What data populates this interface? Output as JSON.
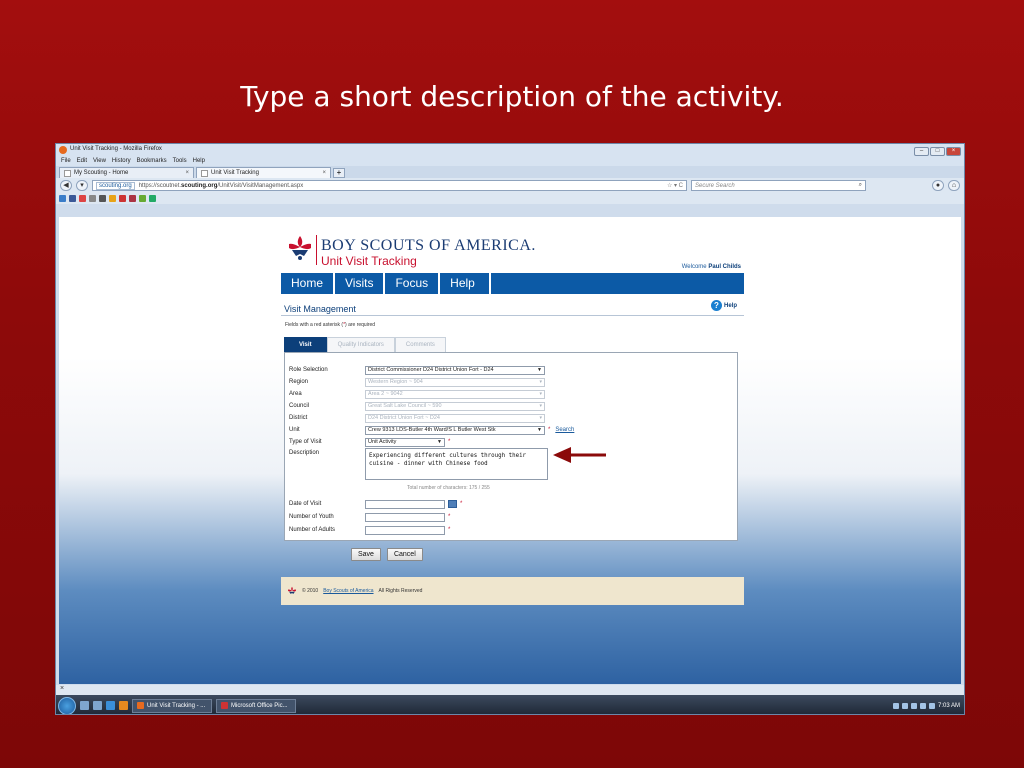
{
  "slide": {
    "title": "Type a short description of the activity."
  },
  "window": {
    "title": "Unit Visit Tracking - Mozilla Firefox",
    "menu": [
      "File",
      "Edit",
      "View",
      "History",
      "Bookmarks",
      "Tools",
      "Help"
    ],
    "tabs": [
      {
        "label": "My Scouting - Home"
      },
      {
        "label": "Unit Visit Tracking"
      }
    ],
    "url_site": "scouting.org",
    "url_prefix": "https://scoutnet.",
    "url_domain": "scouting.org",
    "url_path": "/UnitVisit/VisitManagement.aspx",
    "search_placeholder": "Secure Search",
    "status_text": "×"
  },
  "page": {
    "org_name": "BOY SCOUTS OF AMERICA.",
    "app_name": "Unit Visit Tracking",
    "welcome_prefix": "Welcome",
    "user_name": "Paul Childs",
    "nav": [
      "Home",
      "Visits",
      "Focus",
      "Help"
    ],
    "heading": "Visit Management",
    "help_label": "Help",
    "required_note_before": "Fields with a red asterisk (",
    "required_note_ast": "*",
    "required_note_after": ") are required",
    "subtabs": [
      "Visit",
      "Quality Indicators",
      "Comments"
    ],
    "form": {
      "role_label": "Role Selection",
      "role_value": "District Commissioner D24 District Union Fort - D24",
      "region_label": "Region",
      "region_value": "Western Region ~ 904",
      "area_label": "Area",
      "area_value": "Area 2 ~ 9042",
      "council_label": "Council",
      "council_value": "Great Salt Lake Council ~ 590",
      "district_label": "District",
      "district_value": "D24 District Union Fort ~ D24",
      "unit_label": "Unit",
      "unit_value": "Crew 9313 LDS-Butler 4th Ward/S L Butler West Stk",
      "unit_search": "Search",
      "visit_type_label": "Type of Visit",
      "visit_type_value": "Unit Activity",
      "description_label": "Description",
      "description_value": "Experiencing different cultures through their cuisine - dinner with Chinese food",
      "char_count": "Total number of characters: 175 / 255",
      "date_label": "Date of Visit",
      "youth_label": "Number of Youth",
      "adults_label": "Number of Adults",
      "asterisk": "*"
    },
    "save_label": "Save",
    "cancel_label": "Cancel",
    "footer_copyright": "© 2010",
    "footer_link": "Boy Scouts of America",
    "footer_rights": "All Rights Reserved"
  },
  "taskbar": {
    "items": [
      "Unit Visit Tracking - ...",
      "Microsoft Office Pic..."
    ],
    "clock": "7:03 AM"
  },
  "colors": {
    "slide_bg": "#8e0a0a",
    "nav_blue": "#0c5aa6",
    "bsa_red": "#c8102e",
    "arrow": "#8b0a0a"
  }
}
